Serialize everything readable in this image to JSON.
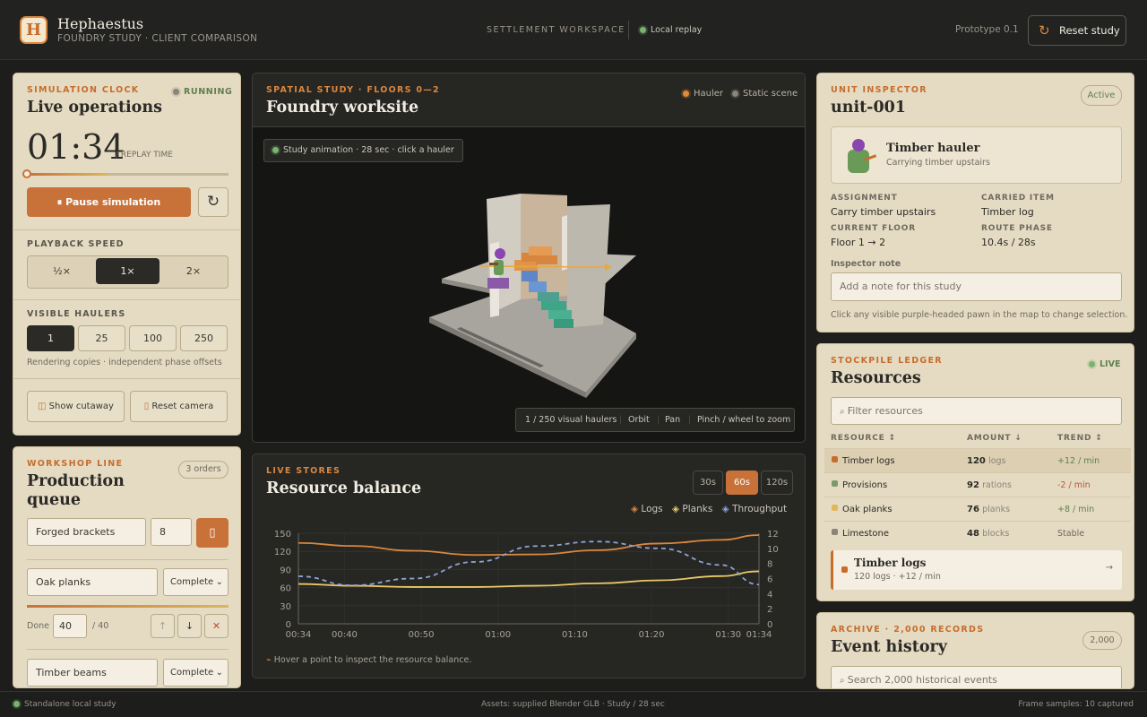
{
  "header": {
    "logo_letter": "H",
    "title": "Hephaestus",
    "subtitle": "FOUNDRY STUDY  ·  CLIENT COMPARISON",
    "workspace": "SETTLEMENT WORKSPACE",
    "replay": "Local replay",
    "prototype": "Prototype 0.1",
    "reset_label": "Reset study"
  },
  "clock": {
    "eyebrow": "SIMULATION CLOCK",
    "status": "RUNNING",
    "title": "Live operations",
    "time": "01:34",
    "time_suffix": "/ REPLAY TIME",
    "progress": 0.0,
    "pause_label": "⏸  Pause simulation",
    "speed_title": "PLAYBACK SPEED",
    "speeds": [
      "½×",
      "1×",
      "2×"
    ],
    "active_speed": "1×",
    "haulers_title": "VISIBLE HAULERS",
    "haulers": [
      "1",
      "25",
      "100",
      "250"
    ],
    "active_haulers": "1",
    "haulers_note": "Rendering copies · independent phase offsets",
    "cutaway_label": "Show cutaway",
    "camera_label": "Reset camera"
  },
  "queue": {
    "eyebrow": "WORKSHOP LINE",
    "title": "Production queue",
    "orders": "3 orders",
    "new_item": "Forged brackets",
    "new_qty": "8",
    "item1": "Oak planks",
    "item1_status": "Complete",
    "done_label": "Done",
    "done_value": "40",
    "done_total": "/ 40",
    "item1_progress": 1.0,
    "item2": "Timber beams",
    "item2_status": "Complete"
  },
  "viewport": {
    "eyebrow": "SPATIAL STUDY · FLOORS 0—2",
    "title": "Foundry worksite",
    "legend_hauler": "Hauler",
    "legend_static": "Static scene",
    "tip": "Study animation · 28 sec · click a hauler",
    "count": "1 / 250 visual haulers",
    "orbit": "Orbit",
    "pan": "Pan",
    "zoom": "Pinch / wheel to zoom"
  },
  "balance": {
    "eyebrow": "LIVE STORES",
    "title": "Resource balance",
    "ranges": [
      "30s",
      "60s",
      "120s"
    ],
    "active_range": "60s",
    "legend": [
      "Logs",
      "Planks",
      "Throughput"
    ],
    "hint": "Hover a point to inspect the resource balance."
  },
  "chart_data": {
    "type": "line",
    "x": [
      "00:34",
      "00:40",
      "00:50",
      "01:00",
      "01:10",
      "01:20",
      "01:30",
      "01:34"
    ],
    "x_seconds": [
      34,
      40,
      50,
      60,
      70,
      80,
      90,
      94
    ],
    "ylim": [
      0,
      150
    ],
    "y_ticks": [
      0,
      30,
      60,
      90,
      120,
      150
    ],
    "y2lim": [
      0,
      12
    ],
    "y2_ticks": [
      0,
      2,
      4,
      6,
      8,
      10,
      12
    ],
    "series": [
      {
        "name": "Logs",
        "axis": "left",
        "color": "#d9873f",
        "values": [
          134,
          129,
          121,
          114,
          115,
          122,
          133,
          139,
          147
        ]
      },
      {
        "name": "Planks",
        "axis": "left",
        "color": "#e9c867",
        "values": [
          66,
          63,
          61,
          61,
          63,
          67,
          72,
          79,
          87
        ]
      },
      {
        "name": "Throughput",
        "axis": "right",
        "color": "#8ea3d6",
        "values": [
          6.3,
          5.1,
          6.0,
          8.2,
          10.3,
          10.9,
          10.0,
          7.8,
          5.2
        ]
      }
    ],
    "series_x": [
      34,
      41,
      49,
      57,
      65,
      73,
      81,
      89,
      94
    ]
  },
  "inspector": {
    "eyebrow": "UNIT INSPECTOR",
    "status": "Active",
    "title": "unit-001",
    "unit_name": "Timber hauler",
    "unit_desc": "Carrying timber upstairs",
    "assignment_label": "ASSIGNMENT",
    "assignment": "Carry timber upstairs",
    "carried_label": "CARRIED ITEM",
    "carried": "Timber log",
    "floor_label": "CURRENT FLOOR",
    "floor": "Floor 1 → 2",
    "phase_label": "ROUTE PHASE",
    "phase": "10.4s / 28s",
    "note_label": "Inspector note",
    "note_placeholder": "Add a note for this study",
    "hint": "Click any visible purple-headed pawn in the map to change selection."
  },
  "ledger": {
    "eyebrow": "STOCKPILE LEDGER",
    "status": "LIVE",
    "title": "Resources",
    "filter_placeholder": "Filter resources",
    "cols": [
      "RESOURCE ↕",
      "AMOUNT ↓",
      "TREND ↕"
    ],
    "rows": [
      {
        "name": "Timber logs",
        "amount": "120",
        "unit": "logs",
        "trend": "+12 / min",
        "color": "#c66d2c"
      },
      {
        "name": "Provisions",
        "amount": "92",
        "unit": "rations",
        "trend": "-2 / min",
        "color": "#7d9a6e"
      },
      {
        "name": "Oak planks",
        "amount": "76",
        "unit": "planks",
        "trend": "+8 / min",
        "color": "#e0b85a"
      },
      {
        "name": "Limestone",
        "amount": "48",
        "unit": "blocks",
        "trend": "Stable",
        "color": "#8a8578"
      }
    ],
    "selected_name": "Timber logs",
    "selected_desc": "120 logs · +12 / min"
  },
  "archive": {
    "eyebrow": "ARCHIVE · 2,000 RECORDS",
    "title": "Event history",
    "count": "2,000",
    "search_placeholder": "Search 2,000 historical events"
  },
  "footer": {
    "left": "Standalone local study",
    "center": "Assets: supplied Blender GLB · Study / 28 sec",
    "right": "Frame samples: 10 captured"
  }
}
